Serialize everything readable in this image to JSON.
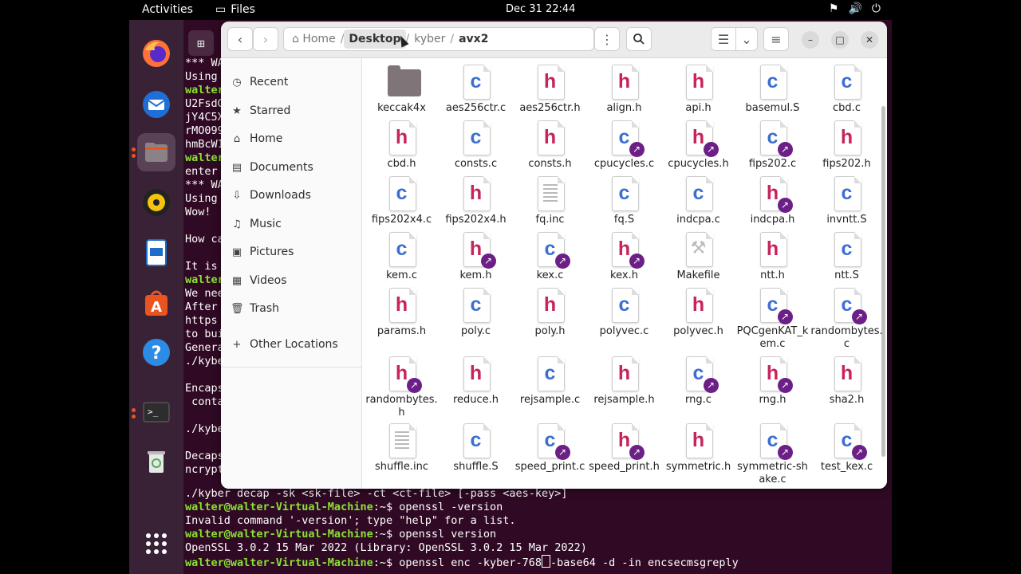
{
  "topbar": {
    "activities": "Activities",
    "app_name": "Files",
    "clock": "Dec 31  22:44",
    "sys_icons": [
      "network-icon",
      "volume-icon",
      "power-icon"
    ]
  },
  "dock": {
    "items": [
      "firefox-icon",
      "thunderbird-icon",
      "files-icon",
      "rhythmbox-icon",
      "writer-icon",
      "software-icon",
      "help-icon",
      "terminal-icon",
      "trash-icon",
      "apps-grid-icon"
    ]
  },
  "terminal": {
    "lines_top": [
      "*** WA",
      "Using",
      "walter",
      "U2FsdG",
      "jY4C5X",
      "rMO099",
      "hmBcW1",
      "walter",
      "enter",
      "*** WA",
      "Using",
      "Wow!",
      "",
      "How ca",
      "",
      "It is",
      "walter",
      "We nee",
      "After",
      "https",
      "to bui",
      "Genera",
      "./kybe",
      "",
      "Encaps",
      " conta",
      "",
      "./kybe",
      "",
      "Decaps",
      "ncrypt"
    ],
    "bottom": {
      "l1": "./kyber decap -sk <sk-file> -ct <ct-file> [-pass <aes-key>]",
      "prompt": "walter@walter-Virtual-Machine",
      "suffix": ":~$ ",
      "cmd1": "openssl -version",
      "l3": "Invalid command '-version'; type \"help\" for a list.",
      "cmd2": "openssl version",
      "l5": "OpenSSL 3.0.2 15 Mar 2022 (Library: OpenSSL 3.0.2 15 Mar 2022)",
      "cmd3a": "openssl enc -kyber-768",
      "cmd3b": "-base64 -d -in encsecmsgreply"
    }
  },
  "files": {
    "path": {
      "home": "Home",
      "desktop": "Desktop",
      "kyber": "kyber",
      "avx2": "avx2"
    },
    "sidebar": [
      {
        "label": "Recent",
        "icon": "clock-icon",
        "glyph": "◷"
      },
      {
        "label": "Starred",
        "icon": "star-icon",
        "glyph": "★"
      },
      {
        "label": "Home",
        "icon": "home-icon",
        "glyph": "⌂"
      },
      {
        "label": "Documents",
        "icon": "documents-icon",
        "glyph": "▤"
      },
      {
        "label": "Downloads",
        "icon": "downloads-icon",
        "glyph": "⇩"
      },
      {
        "label": "Music",
        "icon": "music-icon",
        "glyph": "♫"
      },
      {
        "label": "Pictures",
        "icon": "pictures-icon",
        "glyph": "▣"
      },
      {
        "label": "Videos",
        "icon": "videos-icon",
        "glyph": "▦"
      },
      {
        "label": "Trash",
        "icon": "trash-icon",
        "glyph": "🗑"
      },
      {
        "label": "Other Locations",
        "icon": "plus-icon",
        "glyph": "+"
      }
    ],
    "items": [
      {
        "name": "keccak4x",
        "type": "folder",
        "link": false
      },
      {
        "name": "aes256ctr.c",
        "type": "c",
        "link": false
      },
      {
        "name": "aes256ctr.h",
        "type": "h",
        "link": false
      },
      {
        "name": "align.h",
        "type": "h",
        "link": false
      },
      {
        "name": "api.h",
        "type": "h",
        "link": false
      },
      {
        "name": "basemul.S",
        "type": "c",
        "link": false
      },
      {
        "name": "cbd.c",
        "type": "c",
        "link": false
      },
      {
        "name": "cbd.h",
        "type": "h",
        "link": false
      },
      {
        "name": "consts.c",
        "type": "c",
        "link": false
      },
      {
        "name": "consts.h",
        "type": "h",
        "link": false
      },
      {
        "name": "cpucycles.c",
        "type": "c",
        "link": true
      },
      {
        "name": "cpucycles.h",
        "type": "h",
        "link": true
      },
      {
        "name": "fips202.c",
        "type": "c",
        "link": true
      },
      {
        "name": "fips202.h",
        "type": "h",
        "link": false
      },
      {
        "name": "fips202x4.c",
        "type": "c",
        "link": false
      },
      {
        "name": "fips202x4.h",
        "type": "h",
        "link": false
      },
      {
        "name": "fq.inc",
        "type": "txt",
        "link": false
      },
      {
        "name": "fq.S",
        "type": "c",
        "link": false
      },
      {
        "name": "indcpa.c",
        "type": "c",
        "link": false
      },
      {
        "name": "indcpa.h",
        "type": "h",
        "link": true
      },
      {
        "name": "invntt.S",
        "type": "c",
        "link": false
      },
      {
        "name": "kem.c",
        "type": "c",
        "link": false
      },
      {
        "name": "kem.h",
        "type": "h",
        "link": true
      },
      {
        "name": "kex.c",
        "type": "c",
        "link": true
      },
      {
        "name": "kex.h",
        "type": "h",
        "link": true
      },
      {
        "name": "Makefile",
        "type": "make",
        "link": false
      },
      {
        "name": "ntt.h",
        "type": "h",
        "link": false
      },
      {
        "name": "ntt.S",
        "type": "c",
        "link": false
      },
      {
        "name": "params.h",
        "type": "h",
        "link": false
      },
      {
        "name": "poly.c",
        "type": "c",
        "link": false
      },
      {
        "name": "poly.h",
        "type": "h",
        "link": false
      },
      {
        "name": "polyvec.c",
        "type": "c",
        "link": false
      },
      {
        "name": "polyvec.h",
        "type": "h",
        "link": false
      },
      {
        "name": "PQCgenKAT_kem.c",
        "type": "c",
        "link": true
      },
      {
        "name": "randombytes.c",
        "type": "c",
        "link": true
      },
      {
        "name": "randombytes.h",
        "type": "h",
        "link": true
      },
      {
        "name": "reduce.h",
        "type": "h",
        "link": false
      },
      {
        "name": "rejsample.c",
        "type": "c",
        "link": false
      },
      {
        "name": "rejsample.h",
        "type": "h",
        "link": false
      },
      {
        "name": "rng.c",
        "type": "c",
        "link": true
      },
      {
        "name": "rng.h",
        "type": "h",
        "link": true
      },
      {
        "name": "sha2.h",
        "type": "h",
        "link": false
      },
      {
        "name": "shuffle.inc",
        "type": "txt",
        "link": false
      },
      {
        "name": "shuffle.S",
        "type": "c",
        "link": false
      },
      {
        "name": "speed_print.c",
        "type": "c",
        "link": true
      },
      {
        "name": "speed_print.h",
        "type": "h",
        "link": true
      },
      {
        "name": "symmetric.h",
        "type": "h",
        "link": false
      },
      {
        "name": "symmetric-shake.c",
        "type": "c",
        "link": true
      },
      {
        "name": "test_kex.c",
        "type": "c",
        "link": true
      }
    ]
  }
}
